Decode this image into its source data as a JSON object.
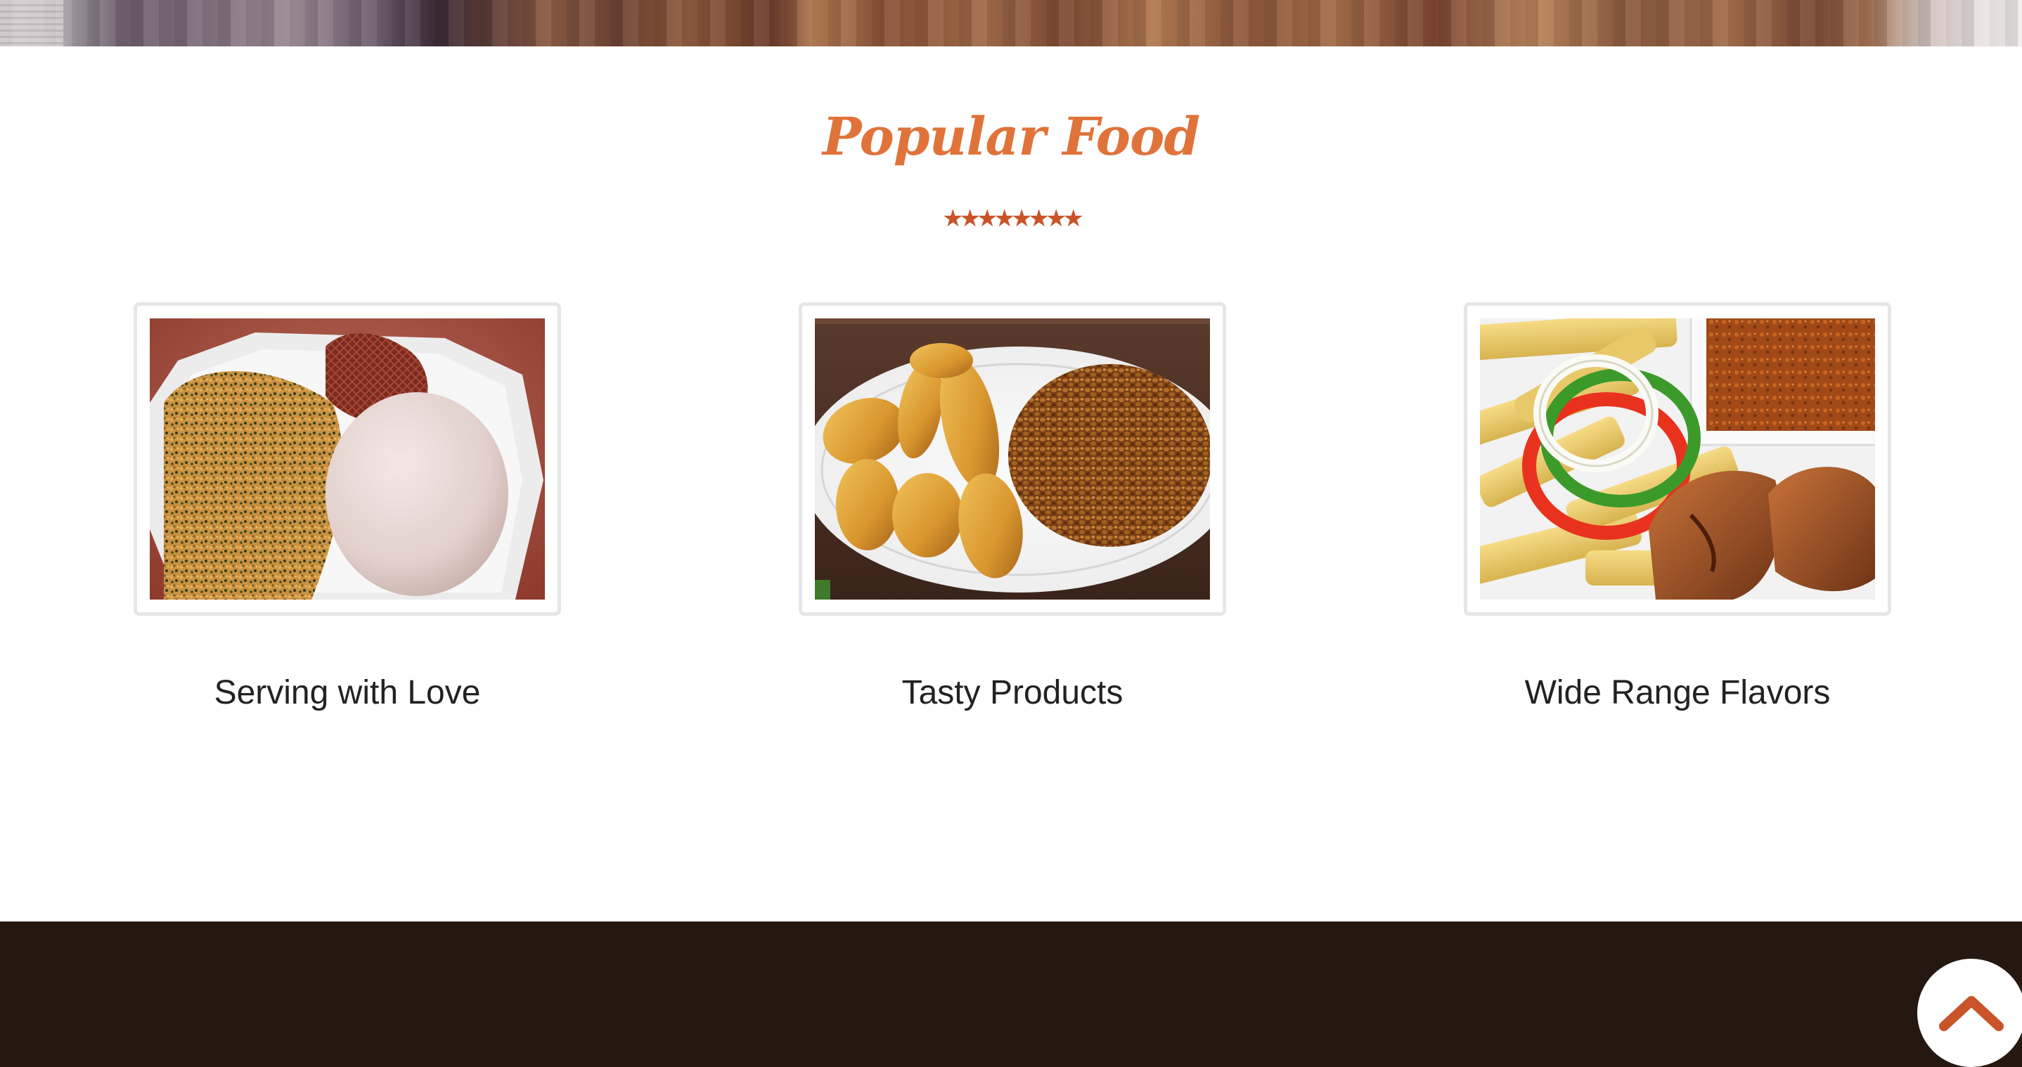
{
  "section": {
    "title": "Popular Food",
    "stars": "★★★★★★★★"
  },
  "cards": [
    {
      "label": "Serving with Love"
    },
    {
      "label": "Tasty Products"
    },
    {
      "label": "Wide Range Flavors"
    }
  ],
  "colors": {
    "title": "#e0733a",
    "stars": "#c9542a",
    "footer": "#251811",
    "back_to_top_icon": "#c9542a"
  },
  "back_to_top": {
    "icon": "chevron-up-icon"
  }
}
